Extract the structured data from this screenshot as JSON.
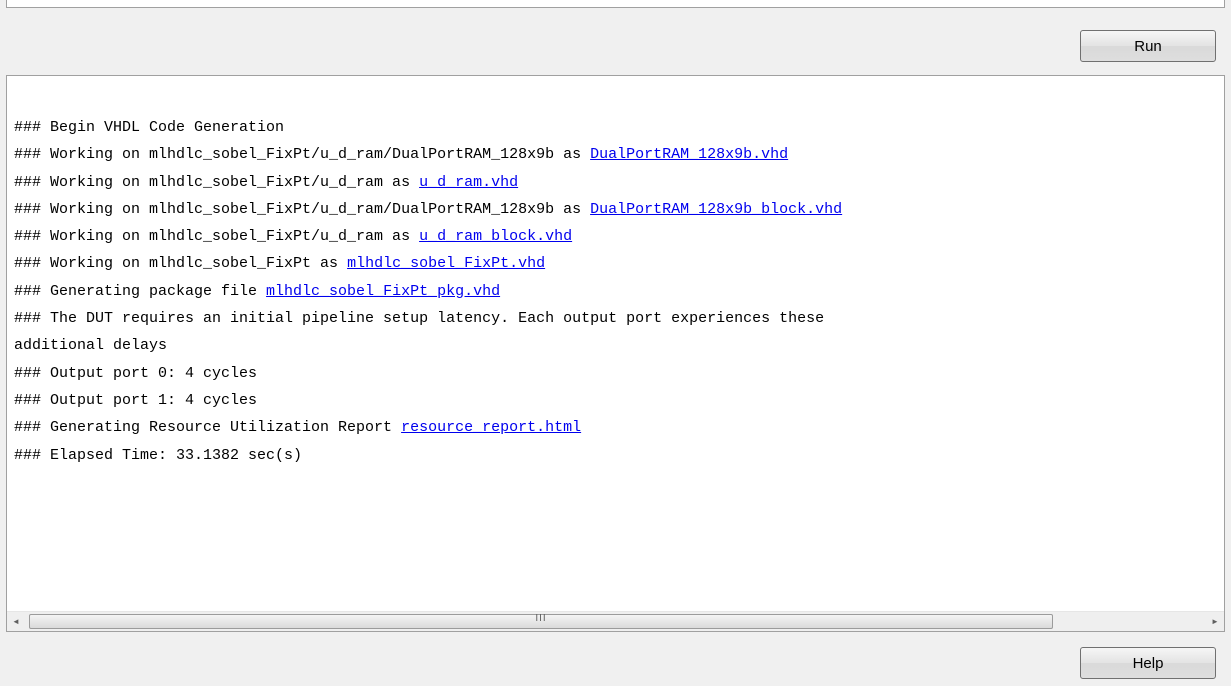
{
  "buttons": {
    "run_label": "Run",
    "help_label": "Help"
  },
  "output": {
    "lines": [
      {
        "text": "### Begin VHDL Code Generation",
        "link": ""
      },
      {
        "text": "### Working on mlhdlc_sobel_FixPt/u_d_ram/DualPortRAM_128x9b as ",
        "link": "DualPortRAM_128x9b.vhd"
      },
      {
        "text": "### Working on mlhdlc_sobel_FixPt/u_d_ram as ",
        "link": "u_d_ram.vhd"
      },
      {
        "text": "### Working on mlhdlc_sobel_FixPt/u_d_ram/DualPortRAM_128x9b as ",
        "link": "DualPortRAM_128x9b_block.vhd"
      },
      {
        "text": "### Working on mlhdlc_sobel_FixPt/u_d_ram as ",
        "link": "u_d_ram_block.vhd"
      },
      {
        "text": "### Working on mlhdlc_sobel_FixPt as ",
        "link": "mlhdlc_sobel_FixPt.vhd"
      },
      {
        "text": "### Generating package file ",
        "link": "mlhdlc_sobel_FixPt_pkg.vhd"
      },
      {
        "text": "### The DUT requires an initial pipeline setup latency. Each output port experiences these",
        "link": ""
      },
      {
        "text": "additional delays",
        "link": ""
      },
      {
        "text": "### Output port 0: 4 cycles",
        "link": ""
      },
      {
        "text": "### Output port 1: 4 cycles",
        "link": ""
      },
      {
        "text": "### Generating Resource Utilization Report ",
        "link": "resource_report.html"
      },
      {
        "text": "### Elapsed Time: 33.1382 sec(s)",
        "link": ""
      }
    ]
  },
  "scrollbar": {
    "left_arrow": "◄",
    "right_arrow": "►",
    "thumb_grip": "III"
  }
}
